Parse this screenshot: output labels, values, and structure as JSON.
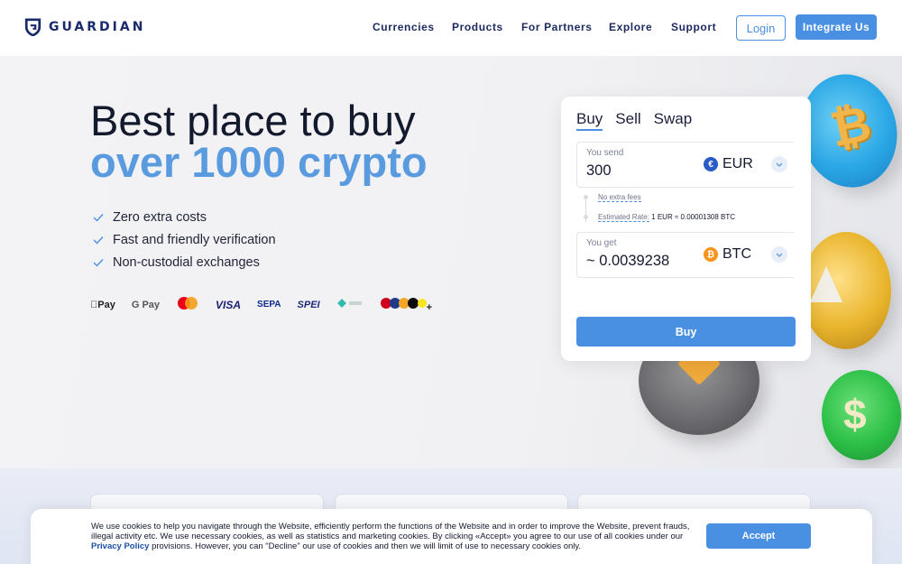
{
  "brand": {
    "name": "GUARDIAN",
    "logo_color": "#1a2b6b"
  },
  "nav": {
    "items": [
      {
        "label": "Currencies"
      },
      {
        "label": "Products"
      },
      {
        "label": "For Partners"
      },
      {
        "label": "Explore"
      },
      {
        "label": "Support"
      }
    ],
    "login_label": "Login",
    "integrate_label": "Integrate Us"
  },
  "hero": {
    "title_line1": "Best place to buy",
    "title_line2": "over 1000 crypto",
    "features": [
      "Zero extra costs",
      "Fast and friendly verification",
      "Non-custodial exchanges"
    ],
    "payment_methods": [
      "Pay",
      "G Pay",
      "VISA",
      "SEPA",
      "SPEI",
      "+"
    ]
  },
  "widget": {
    "tabs": [
      "Buy",
      "Sell",
      "Swap"
    ],
    "active_tab": "Buy",
    "send": {
      "label": "You send",
      "value": "300",
      "currency": "EUR",
      "currency_color": "#2a5cc7"
    },
    "fees": {
      "no_fees": "No extra fees",
      "rate_label": "Estimated Rate:",
      "rate_value": "1 EUR ≈ 0.00001308 BTC"
    },
    "get": {
      "label": "You get",
      "value": "~ 0.0039238",
      "currency": "BTC",
      "currency_color": "#f7931a"
    },
    "buy_label": "Buy"
  },
  "coins": {
    "btc_symbol": "₿",
    "usdt_symbol": "$"
  },
  "cookie": {
    "text_before_link": "We use cookies to help you navigate through the Website, efficiently perform the functions of the Website and in order to improve the Website, prevent frauds, illegal activity etc. We use necessary cookies, as well as statistics and marketing cookies. By clicking «Accept» you agree to our use of all cookies under our ",
    "link_text": "Privacy Policy",
    "text_after_link": " provisions. However, you can \"Decline\" our use of cookies and then we will limit of use to necessary cookies only.",
    "accept_label": "Accept"
  },
  "colors": {
    "accent": "#4a90e2",
    "title_blue": "#5a9be0",
    "text_dark": "#141a2e"
  }
}
